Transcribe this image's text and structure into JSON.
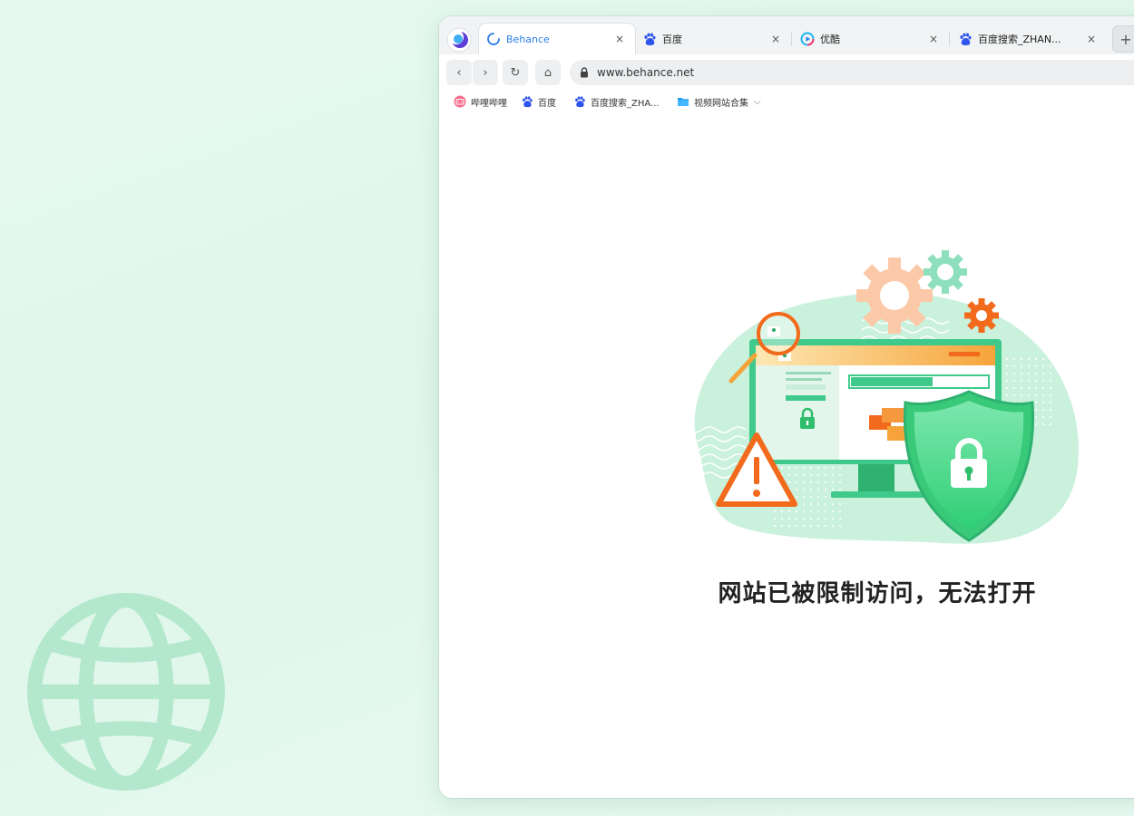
{
  "browser": {
    "tabs": [
      {
        "label": "Behance",
        "icon": "loading-spinner-icon",
        "active": true,
        "close": "×"
      },
      {
        "label": "百度",
        "icon": "baidu-paw-icon",
        "active": false,
        "close": "×"
      },
      {
        "label": "优酷",
        "icon": "youku-play-icon",
        "active": false,
        "close": "×"
      },
      {
        "label": "百度搜索_ZHAN...",
        "icon": "baidu-paw-icon",
        "active": false,
        "close": "×"
      }
    ],
    "new_tab_label": "+",
    "nav": {
      "back": "‹",
      "forward": "›",
      "reload": "↻",
      "home": "⌂"
    },
    "url": "www.behance.net",
    "bookmarks": [
      {
        "label": "哔哩哔哩",
        "icon": "bilibili-icon"
      },
      {
        "label": "百度",
        "icon": "baidu-paw-icon"
      },
      {
        "label": "百度搜索_ZHA...",
        "icon": "baidu-paw-icon"
      },
      {
        "label": "视频网站合集",
        "icon": "folder-icon",
        "has_dropdown": true
      }
    ],
    "bookmark_dropdown": "⌵"
  },
  "page": {
    "message": "网站已被限制访问，无法打开"
  },
  "colors": {
    "accent_blue": "#2b7de9",
    "shield_green": "#3ed07f",
    "warning_orange": "#f26a1b",
    "blob_mint": "#c9f1dc"
  }
}
